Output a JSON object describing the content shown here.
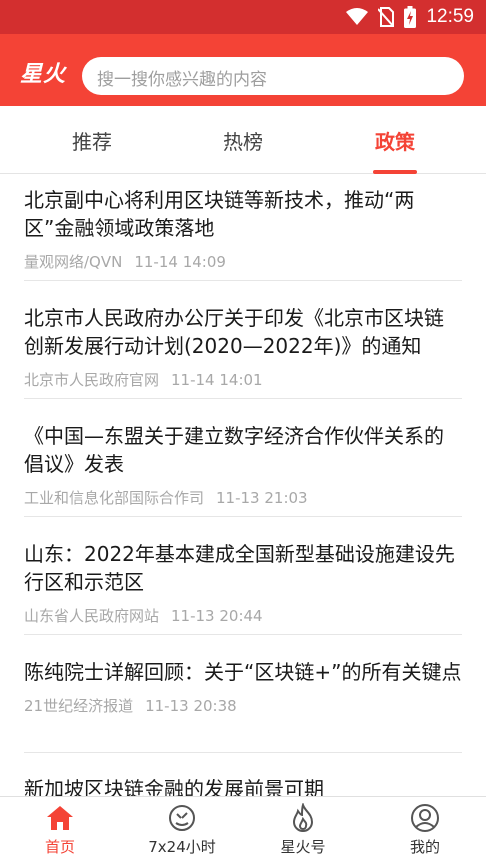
{
  "status_bar": {
    "time": "12:59",
    "icons": [
      "wifi-icon",
      "no-sim-icon",
      "battery-charging-icon"
    ]
  },
  "header": {
    "logo_text": "星火",
    "search": {
      "placeholder": "搜一搜你感兴趣的内容"
    }
  },
  "tabs": [
    {
      "label": "推荐",
      "active": false
    },
    {
      "label": "热榜",
      "active": false
    },
    {
      "label": "政策",
      "active": true
    }
  ],
  "articles": [
    {
      "title": "北京副中心将利用区块链等新技术，推动“两区”金融领域政策落地",
      "source": "量观网络/QVN",
      "time": "11-14 14:09"
    },
    {
      "title": "北京市人民政府办公厅关于印发《北京市区块链创新发展行动计划(2020—2022年)》的通知",
      "source": "北京市人民政府官网",
      "time": "11-14 14:01"
    },
    {
      "title": "《中国—东盟关于建立数字经济合作伙伴关系的倡议》发表",
      "source": "工业和信息化部国际合作司",
      "time": "11-13 21:03"
    },
    {
      "title": "山东：2022年基本建成全国新型基础设施建设先行区和示范区",
      "source": "山东省人民政府网站",
      "time": "11-13 20:44"
    },
    {
      "title": "陈纯院士详解回顾：关于“区块链+”的所有关键点",
      "source": "21世纪经济报道",
      "time": "11-13 20:38"
    },
    {
      "title": "新加坡区块链金融的发展前景可期",
      "source": "",
      "time": ""
    }
  ],
  "bottom_nav": [
    {
      "label": "首页",
      "icon": "home-icon",
      "active": true
    },
    {
      "label": "7x24小时",
      "icon": "clock-icon",
      "active": false
    },
    {
      "label": "星火号",
      "icon": "flame-icon",
      "active": false
    },
    {
      "label": "我的",
      "icon": "profile-icon",
      "active": false
    }
  ],
  "colors": {
    "status_bar": "#d32f2f",
    "brand_red": "#f44336",
    "meta_gray": "#a8a8a8"
  }
}
